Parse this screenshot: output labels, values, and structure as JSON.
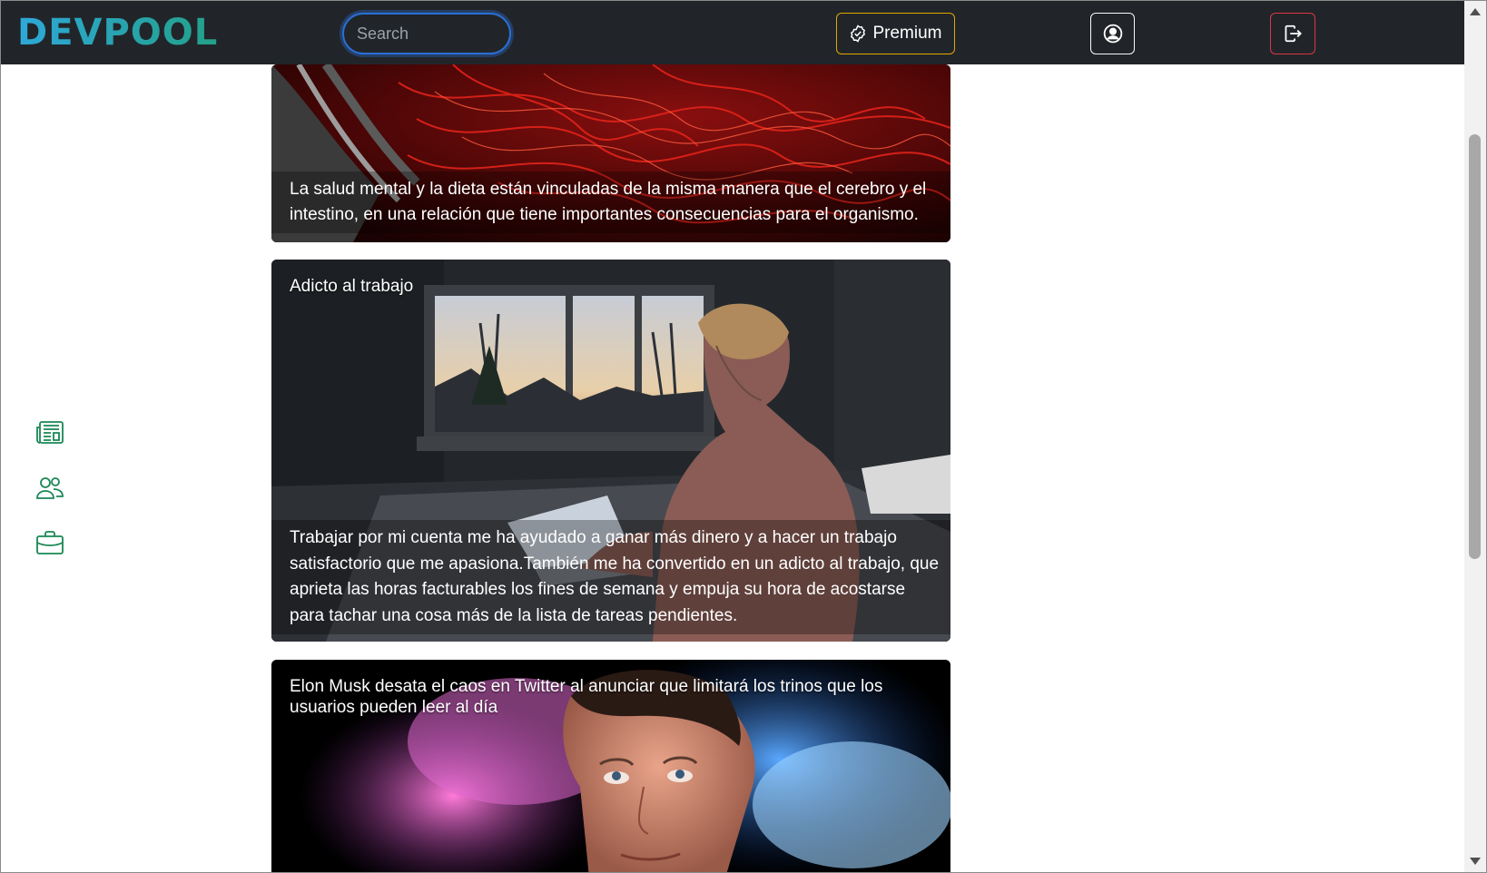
{
  "header": {
    "brand": "DEVPOOL",
    "search_placeholder": "Search",
    "premium_label": "Premium"
  },
  "icons": {
    "premium": "badge-check-icon",
    "user": "person-circle-icon",
    "logout": "box-arrow-right-icon",
    "sidebar": [
      "newspaper-icon",
      "people-icon",
      "briefcase-icon"
    ]
  },
  "colors": {
    "navbar_bg": "#212529",
    "premium_border": "#e0a800",
    "logout_border": "#dc3545",
    "sidebar_icon": "#198754",
    "brand_gradient": [
      "#2ea8d8",
      "#23a089"
    ]
  },
  "posts": [
    {
      "title": "",
      "image": "saffron threads in a bowl",
      "body": "La salud mental y la dieta están vinculadas de la misma manera que el cerebro y el intestino, en una relación que tiene importantes consecuencias para el organismo."
    },
    {
      "title": "Adicto al trabajo",
      "image": "person working on a laptop on a bed at dusk",
      "body": "Trabajar por mi cuenta me ha ayudado a ganar más dinero y a hacer un trabajo satisfactorio que me apasiona.También me ha convertido en un adicto al trabajo, que aprieta las horas facturables los fines de semana y empuja su hora de acostarse para tachar una cosa más de la lista de tareas pendientes."
    },
    {
      "title": "Elon Musk desata el caos en Twitter al anunciar que limitará los trinos que los usuarios pueden leer al día",
      "image": "Elon Musk in front of a blurred Twitter bird logo",
      "body": ""
    }
  ]
}
